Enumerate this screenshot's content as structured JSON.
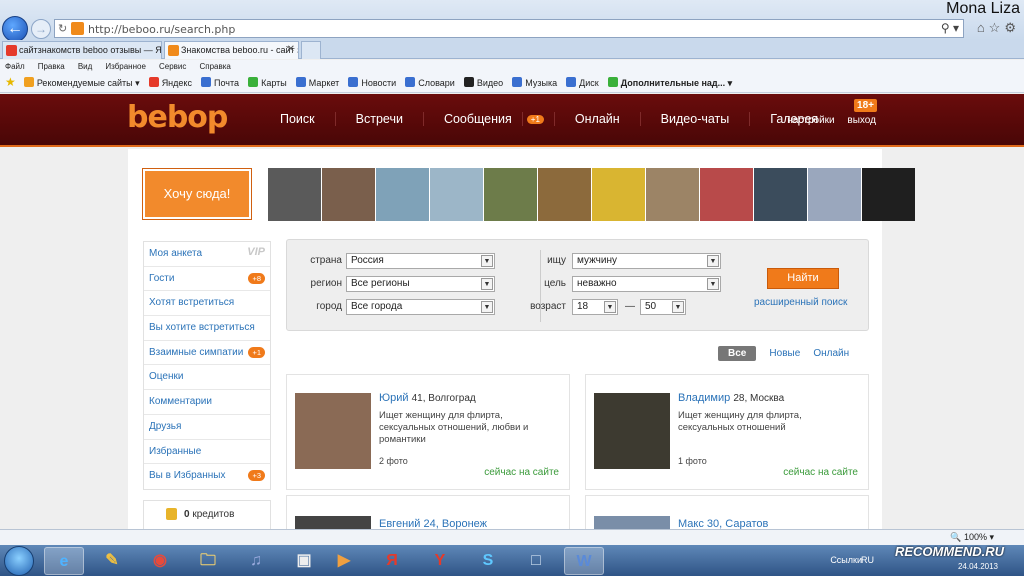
{
  "browser": {
    "user": "Mona Liza",
    "url": "http://beboo.ru/search.php",
    "tabs": [
      {
        "label": "сайтзнакомств beboo отзывы — Ян..."
      },
      {
        "label": "Знакомства beboo.ru - сайт знак..."
      }
    ],
    "menu": [
      "Файл",
      "Правка",
      "Вид",
      "Избранное",
      "Сервис",
      "Справка"
    ],
    "favorites": [
      "Рекомендуемые сайты",
      "Яндекс",
      "Почта",
      "Карты",
      "Маркет",
      "Новости",
      "Словари",
      "Видео",
      "Музыка",
      "Диск",
      "Дополнительные над..."
    ]
  },
  "header": {
    "logo": "bebop",
    "nav": [
      {
        "label": "Поиск"
      },
      {
        "label": "Встречи"
      },
      {
        "label": "Сообщения",
        "badge": "+1"
      },
      {
        "label": "Онлайн"
      },
      {
        "label": "Видео-чаты"
      },
      {
        "label": "Галерея"
      }
    ],
    "settings": "настройки",
    "logout": "выход",
    "age": "18+"
  },
  "promo": {
    "button": "Хочу сюда!",
    "photo_colors": [
      "#5a5a5a",
      "#7a5f4c",
      "#7fa2b8",
      "#9cb6c8",
      "#6d7c4a",
      "#8c6a3c",
      "#d9b531",
      "#9c8466",
      "#b84a4a",
      "#3b4c5c",
      "#9aa7bd",
      "#1f1f1f"
    ]
  },
  "sidebar": {
    "items": [
      {
        "label": "Моя анкета",
        "vip": "VIP"
      },
      {
        "label": "Гости",
        "badge": "+8"
      },
      {
        "label": "Хотят встретиться"
      },
      {
        "label": "Вы хотите встретиться"
      },
      {
        "label": "Взаимные симпатии",
        "badge": "+1"
      },
      {
        "label": "Оценки"
      },
      {
        "label": "Комментарии"
      },
      {
        "label": "Друзья"
      },
      {
        "label": "Избранные"
      },
      {
        "label": "Вы в Избранных",
        "badge": "+3"
      }
    ],
    "credits_count": "0",
    "credits_label": "кредитов"
  },
  "search": {
    "country_label": "страна",
    "country_value": "Россия",
    "region_label": "регион",
    "region_value": "Все регионы",
    "city_label": "город",
    "city_value": "Все города",
    "seek_label": "ищу",
    "seek_value": "мужчину",
    "goal_label": "цель",
    "goal_value": "неважно",
    "age_label": "возраст",
    "age_from": "18",
    "age_to": "50",
    "age_dash": "—",
    "find_button": "Найти",
    "advanced_link": "расширенный поиск"
  },
  "filters": {
    "all": "Все",
    "new": "Новые",
    "online": "Онлайн"
  },
  "cards": [
    {
      "name": "Юрий",
      "age": "41",
      "city": "Волгоград",
      "desc": "Ищет женщину для флирта, сексуальных отношений, любви и романтики",
      "photos": "2 фото",
      "status": "сейчас на сайте",
      "photo_color": "#8a6a55"
    },
    {
      "name": "Владимир",
      "age": "28",
      "city": "Москва",
      "desc": "Ищет женщину для флирта, сексуальных отношений",
      "photos": "1 фото",
      "status": "сейчас на сайте",
      "photo_color": "#3d3a30"
    },
    {
      "name": "Евгений",
      "age": "24",
      "city": "Воронеж",
      "photo_color": "#444444"
    },
    {
      "name": "Макс",
      "age": "30",
      "city": "Саратов",
      "photo_color": "#7a8ea8"
    }
  ],
  "status": {
    "zoom": "100%"
  },
  "taskbar": {
    "links": "Ссылки",
    "lang": "RU",
    "date": "24.04.2013",
    "watermark": "RECOMMEND.RU"
  }
}
